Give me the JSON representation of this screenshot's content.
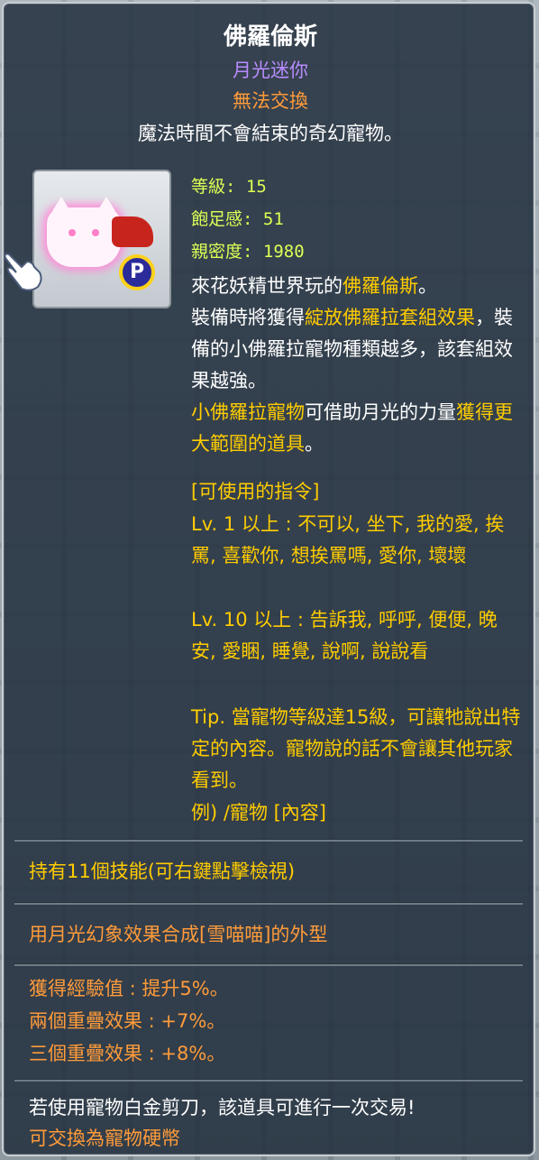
{
  "item": {
    "name": "佛羅倫斯",
    "type": "月光迷你",
    "trade_status": "無法交換",
    "tagline": "魔法時間不會結束的奇幻寵物。",
    "icon": "cat-pet-with-red-cape-icon",
    "badge": "P"
  },
  "stats": {
    "level": "等級: 15",
    "fullness": "飽足感: 51",
    "closeness": "親密度: 1980"
  },
  "description": {
    "p1_a": "來花妖精世界玩的",
    "p1_name": "佛羅倫斯",
    "p1_b": "。",
    "p2_a": "裝備時將獲得",
    "p2_set": "綻放佛羅拉套組效果",
    "p2_b": "，裝備的小佛羅拉寵物種類越多，該套組效果越強。",
    "p3_a": "小佛羅拉寵物",
    "p3_b": "可借助月光的力量",
    "p3_c": "獲得更大範圍的道具",
    "p3_d": "。"
  },
  "commands": {
    "header": "[可使用的指令]",
    "lv1": "Lv. 1 以上 : 不可以, 坐下, 我的愛, 挨罵, 喜歡你, 想挨罵嗎, 愛你, 壞壞",
    "lv10": "Lv. 10 以上 : 告訴我, 呼呼, 便便, 晚安, 愛睏, 睡覺, 說啊, 說說看",
    "tip": "Tip. 當寵物等級達15級，可讓牠說出特定的內容。寵物說的話不會讓其他玩家看到。",
    "example": "例) /寵物 [內容]"
  },
  "skills": "持有11個技能(可右鍵點擊檢視)",
  "synthesis": "用月光幻象效果合成[雪喵喵]的外型",
  "effects": [
    "獲得經驗值 : 提升5%。",
    "兩個重疊效果 : +7%。",
    "三個重疊效果 : +8%。"
  ],
  "footer": {
    "platinum_scissors": "若使用寵物白金剪刀，該道具可進行一次交易!",
    "exchange": "可交換為寵物硬幣"
  },
  "colors": {
    "title": "#ffffff",
    "type": "#b98cff",
    "trade": "#ff9b3a",
    "stat": "#ddff55",
    "highlight": "#ffcc00",
    "panel": "#222e3c"
  }
}
